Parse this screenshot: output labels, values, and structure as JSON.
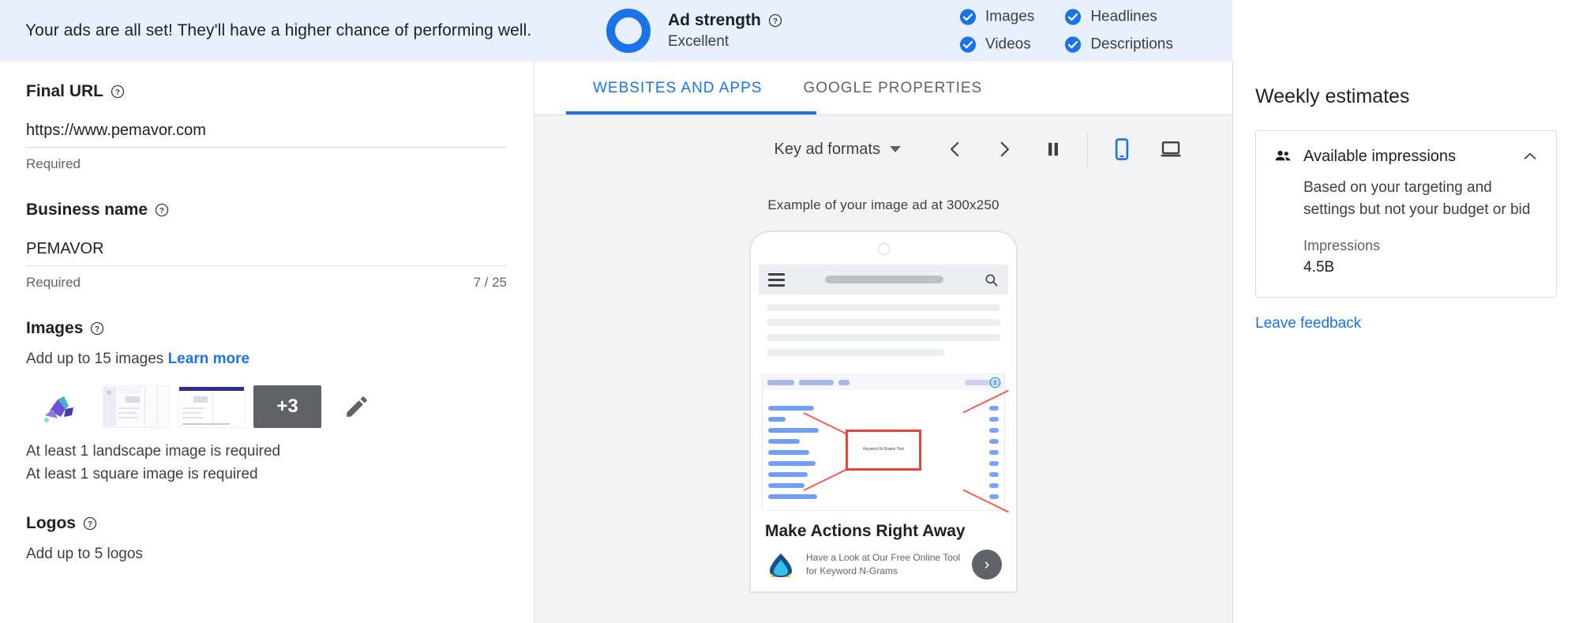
{
  "banner": {
    "message": "Your ads are all set! They'll have a higher chance of performing well.",
    "ad_strength_label": "Ad strength",
    "ad_strength_value": "Excellent",
    "help_icon": "help-circle-icon",
    "ring_color": "#1a73e8",
    "background_color": "#e8f0fe",
    "checks": [
      {
        "label": "Images",
        "icon": "check-circle-icon",
        "checked": true
      },
      {
        "label": "Headlines",
        "icon": "check-circle-icon",
        "checked": true
      },
      {
        "label": "Videos",
        "icon": "check-circle-icon",
        "checked": true
      },
      {
        "label": "Descriptions",
        "icon": "check-circle-icon",
        "checked": true
      }
    ]
  },
  "left_panel": {
    "final_url": {
      "label": "Final URL",
      "value": "https://www.pemavor.com",
      "helper": "Required"
    },
    "business_name": {
      "label": "Business name",
      "value": "PEMAVOR",
      "helper": "Required",
      "counter": "7 / 25"
    },
    "images": {
      "label": "Images",
      "subtitle_text": "Add up to 15 images",
      "learn_more": "Learn more",
      "more_badge": "+3",
      "edit_icon": "pencil-icon",
      "requirements": [
        "At least 1 landscape image is required",
        "At least 1 square image is required"
      ]
    },
    "logos": {
      "label": "Logos",
      "subtitle_text": "Add up to 5 logos"
    }
  },
  "center_panel": {
    "tabs": [
      {
        "label": "WEBSITES AND APPS",
        "active": true
      },
      {
        "label": "GOOGLE PROPERTIES",
        "active": false
      }
    ],
    "toolbar": {
      "format_select": "Key ad formats",
      "prev_icon": "chevron-left-icon",
      "next_icon": "chevron-right-icon",
      "pause_icon": "pause-icon",
      "mobile_icon": "mobile-device-icon",
      "desktop_icon": "desktop-device-icon",
      "active_device": "mobile",
      "active_color": "#1a73e8"
    },
    "preview": {
      "caption": "Example of your image ad at 300x250",
      "ad_headline": "Make Actions Right Away",
      "ad_description": "Have a Look at Our Free Online Tool for Keyword N-Grams",
      "cta_icon": "chevron-right-icon",
      "ad_info_icon": "ad-info-icon",
      "menu_icon": "hamburger-menu-icon",
      "search_icon": "search-icon"
    }
  },
  "right_panel": {
    "title": "Weekly estimates",
    "card": {
      "header_label": "Available impressions",
      "header_icon": "people-icon",
      "collapse_icon": "chevron-up-icon",
      "description": "Based on your targeting and settings but not your budget or bid",
      "metric_label": "Impressions",
      "metric_value": "4.5B"
    },
    "feedback_link": "Leave feedback"
  }
}
